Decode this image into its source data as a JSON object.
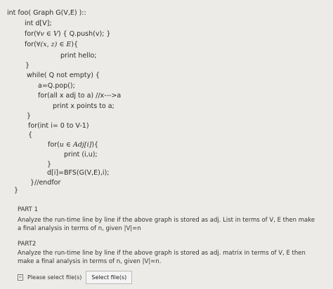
{
  "code": {
    "lines": [
      "int foo( Graph G(V,E) )::",
      "int d[V];",
      "for(",
      "for(",
      "print hello;",
      "}",
      "while( Q not empty) {",
      "a=Q.pop();",
      "for(all x adj to a) //x--->a",
      "print x points to a;",
      "}",
      "for(int i= 0 to V-1)",
      "{",
      "for(",
      "print (i,u);",
      "}",
      "d[i]=BFS(G(V,E),i);",
      "}//endfor",
      "}"
    ],
    "math": {
      "forall_v_in_V": "∀v ∈ V",
      "push_tail": ") { Q.push(v);  }",
      "forall_xz_in_E": "∀(x, z) ∈ E",
      "brace_tail": "){",
      "u_in_adj": "u ∈ Adj[i]",
      "brace_tail2": "){"
    }
  },
  "part1": {
    "label": "PART 1",
    "text": "Analyze the run-time line by line if the above graph is stored as adj. List in terms of V, E then make a final analysis in terms of n, given  |V|=n"
  },
  "part2": {
    "label": "PART2",
    "text": "Analyze the run-time line by line if the above graph is stored as adj. matrix in terms of V, E then make a final analysis in terms of n, given  |V|=n."
  },
  "file": {
    "icon": "file-icon",
    "prompt": "Please select file(s)",
    "button_label": "Select file(s)"
  }
}
